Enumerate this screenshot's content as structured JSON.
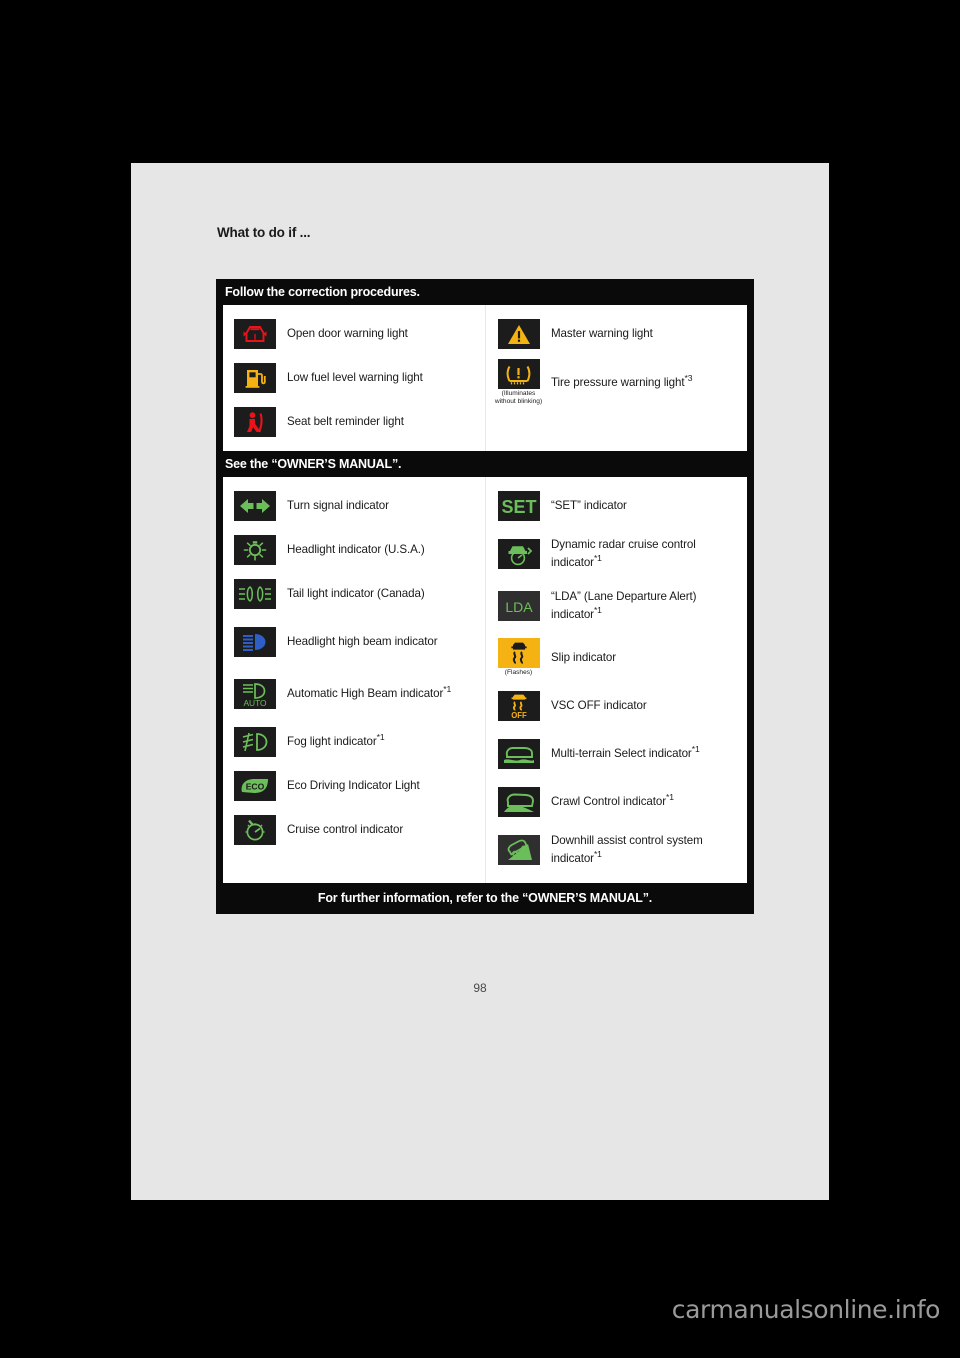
{
  "page": {
    "heading": "What to do if ...",
    "number": "98"
  },
  "watermark": "carmanualsonline.info",
  "sections": [
    {
      "band_title": "Follow the correction procedures.",
      "left_items": [
        {
          "icon": "open-door-warning-icon",
          "label": "Open door warning light",
          "note": ""
        },
        {
          "icon": "low-fuel-warning-icon",
          "label": "Low fuel level warning light",
          "note": ""
        },
        {
          "icon": "seat-belt-reminder-icon",
          "label": "Seat belt reminder light",
          "note": ""
        }
      ],
      "right_items": [
        {
          "icon": "master-warning-icon",
          "label": "Master warning light",
          "note": "",
          "footnote": ""
        },
        {
          "icon": "tire-pressure-warning-icon",
          "label": "Tire pressure warning light",
          "footnote": "*3",
          "note": "(Illuminates without blinking)"
        }
      ]
    },
    {
      "band_title": "See the “OWNER’S MANUAL”.",
      "left_items": [
        {
          "icon": "turn-signal-icon",
          "label": "Turn signal indicator",
          "footnote": "",
          "note": ""
        },
        {
          "icon": "headlight-icon",
          "label": "Headlight indicator (U.S.A.)",
          "footnote": "",
          "note": ""
        },
        {
          "icon": "tail-light-icon",
          "label": "Tail light indicator (Canada)",
          "footnote": "",
          "note": ""
        },
        {
          "icon": "high-beam-icon",
          "label": "Headlight high beam indicator",
          "footnote": "",
          "note": ""
        },
        {
          "icon": "automatic-high-beam-icon",
          "label": "Automatic High Beam indicator",
          "footnote": "*1",
          "note": ""
        },
        {
          "icon": "fog-light-icon",
          "label": "Fog light indicator",
          "footnote": "*1",
          "note": ""
        },
        {
          "icon": "eco-driving-icon",
          "label": "Eco Driving Indicator Light",
          "footnote": "",
          "note": ""
        },
        {
          "icon": "cruise-control-icon",
          "label": "Cruise control indicator",
          "footnote": "",
          "note": ""
        }
      ],
      "right_items": [
        {
          "icon": "set-indicator-icon",
          "label": "“SET” indicator",
          "footnote": "",
          "note": ""
        },
        {
          "icon": "dynamic-radar-cruise-icon",
          "label": "Dynamic radar cruise control indicator",
          "footnote": "*1",
          "note": ""
        },
        {
          "icon": "lda-indicator-icon",
          "label": "“LDA” (Lane Departure Alert) indicator",
          "footnote": "*1",
          "note": ""
        },
        {
          "icon": "slip-indicator-icon",
          "label": "Slip indicator",
          "footnote": "",
          "note": "(Flashes)"
        },
        {
          "icon": "vsc-off-icon",
          "label": "VSC OFF indicator",
          "footnote": "",
          "note": ""
        },
        {
          "icon": "multi-terrain-select-icon",
          "label": "Multi-terrain Select indicator",
          "footnote": "*1",
          "note": ""
        },
        {
          "icon": "crawl-control-icon",
          "label": "Crawl Control indicator",
          "footnote": "*1",
          "note": ""
        },
        {
          "icon": "downhill-assist-icon",
          "label": "Downhill assist control system indicator",
          "footnote": "*1",
          "note": ""
        }
      ]
    }
  ],
  "footer_band": "For further information, refer to the “OWNER’S MANUAL”.",
  "colors": {
    "red": "#e8131b",
    "amber": "#f4b313",
    "green": "#6cbe5a",
    "blue": "#2f5fc4",
    "icon_bg": "#1c1c1c",
    "page_bg": "#e6e6e6"
  }
}
